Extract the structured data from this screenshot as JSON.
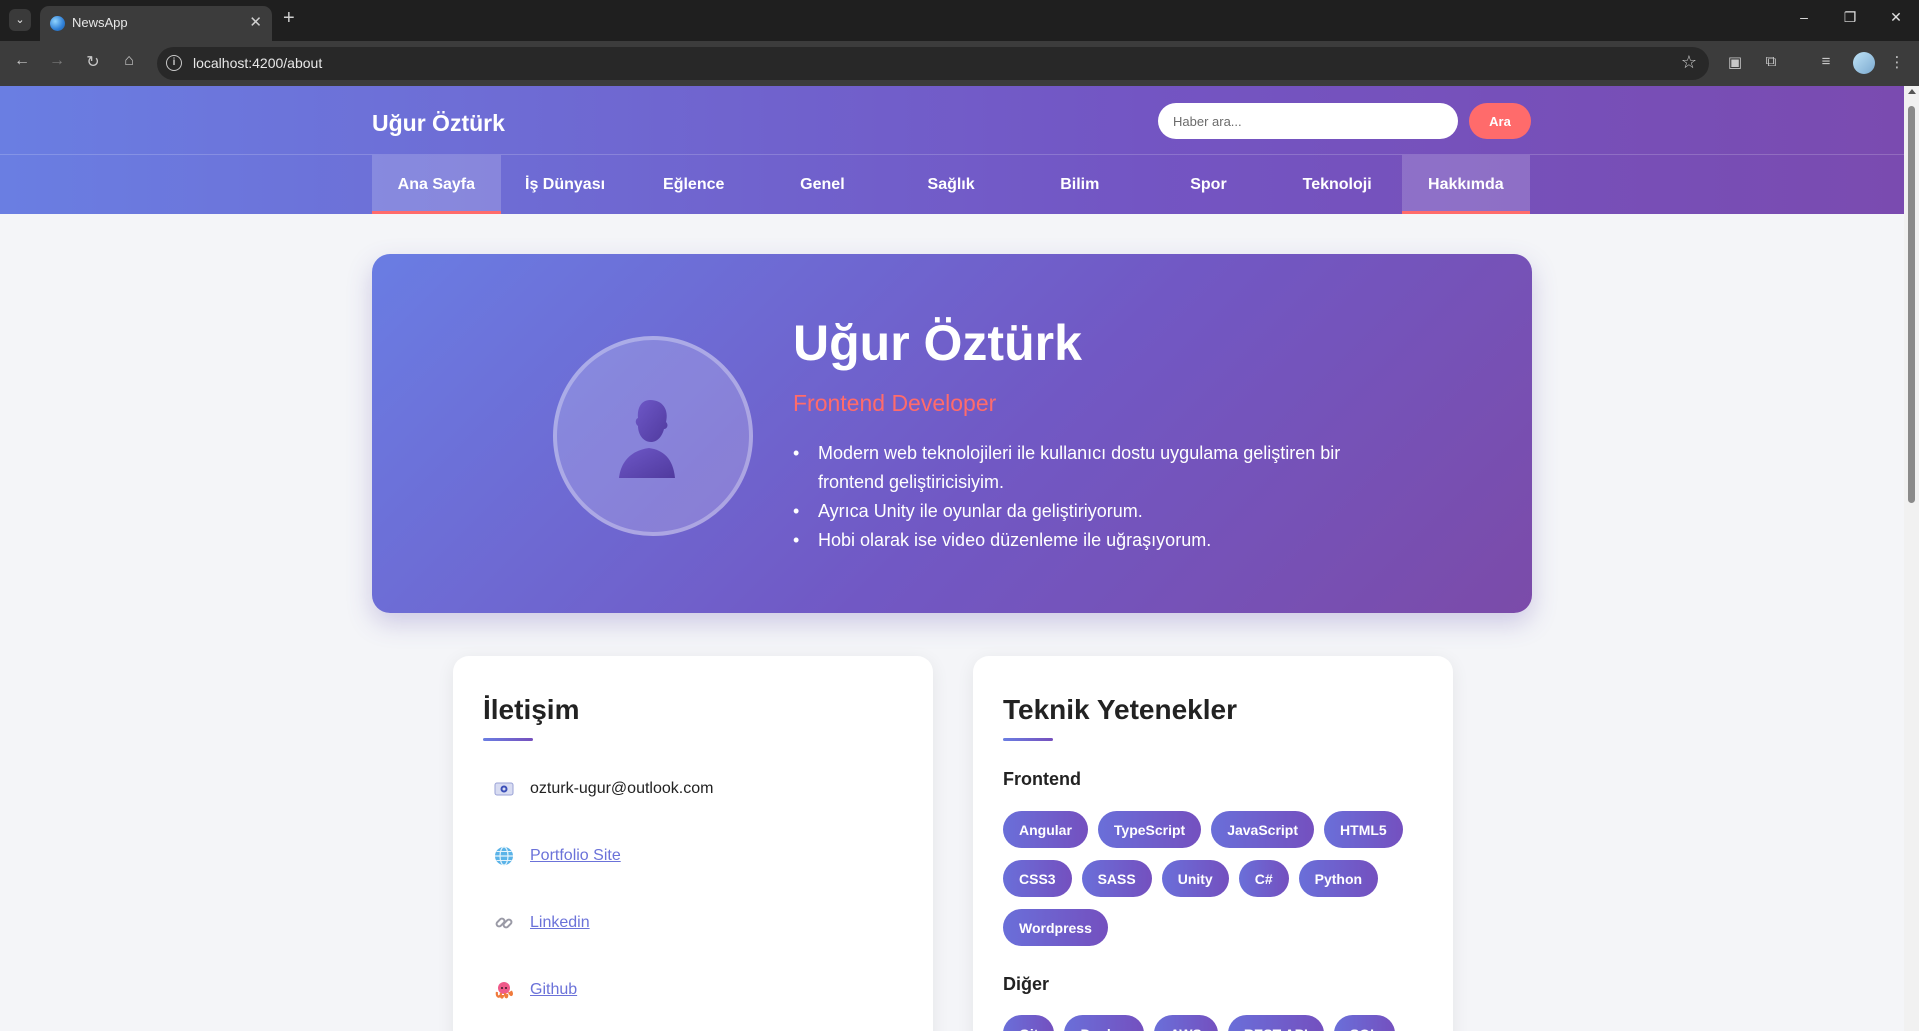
{
  "browser": {
    "tab_title": "NewsApp",
    "url": "localhost:4200/about"
  },
  "header": {
    "brand": "Uğur Öztürk",
    "search_placeholder": "Haber ara...",
    "search_button": "Ara",
    "nav": [
      {
        "label": "Ana Sayfa",
        "active": true
      },
      {
        "label": "İş Dünyası",
        "active": false
      },
      {
        "label": "Eğlence",
        "active": false
      },
      {
        "label": "Genel",
        "active": false
      },
      {
        "label": "Sağlık",
        "active": false
      },
      {
        "label": "Bilim",
        "active": false
      },
      {
        "label": "Spor",
        "active": false
      },
      {
        "label": "Teknoloji",
        "active": false
      },
      {
        "label": "Hakkımda",
        "active": true
      }
    ]
  },
  "hero": {
    "name": "Uğur Öztürk",
    "role": "Frontend Developer",
    "bullets": [
      "Modern web teknolojileri ile kullanıcı dostu uygulama geliştiren bir frontend geliştiricisiyim.",
      "Ayrıca Unity ile oyunlar da geliştiriyorum.",
      "Hobi olarak ise video düzenleme ile uğraşıyorum."
    ]
  },
  "contact": {
    "title": "İletişim",
    "items": [
      {
        "icon": "email-icon",
        "text": "ozturk-ugur@outlook.com",
        "link": false
      },
      {
        "icon": "globe-icon",
        "text": "Portfolio Site",
        "link": true
      },
      {
        "icon": "link-icon",
        "text": "Linkedin",
        "link": true
      },
      {
        "icon": "octocat-icon",
        "text": "Github",
        "link": true
      }
    ]
  },
  "skills": {
    "title": "Teknik Yetenekler",
    "groups": [
      {
        "name": "Frontend",
        "items": [
          "Angular",
          "TypeScript",
          "JavaScript",
          "HTML5",
          "CSS3",
          "SASS",
          "Unity",
          "C#",
          "Python",
          "Wordpress"
        ]
      },
      {
        "name": "Diğer",
        "items": [
          "Git",
          "Docker",
          "AWS",
          "REST API",
          "SQL"
        ]
      }
    ]
  },
  "colors": {
    "accent": "#ff6b6b",
    "gradient_start": "#6a7ee2",
    "gradient_end": "#7b4ba9"
  }
}
